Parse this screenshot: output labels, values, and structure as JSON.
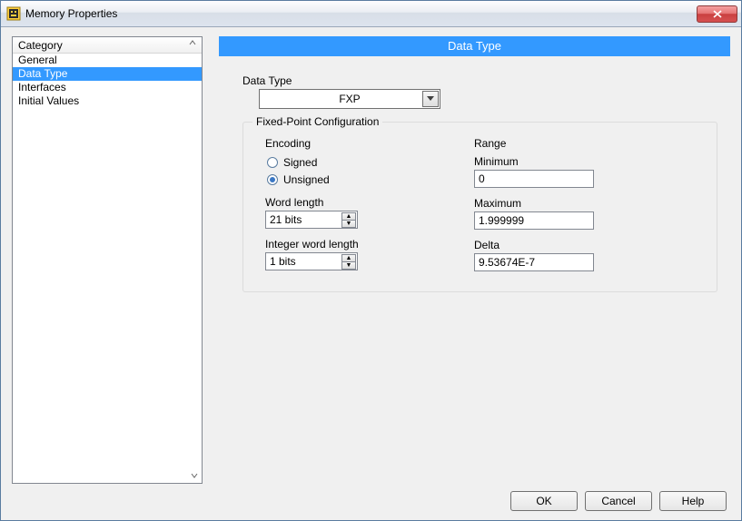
{
  "window": {
    "title": "Memory Properties"
  },
  "sidebar": {
    "header": "Category",
    "items": [
      {
        "label": "General",
        "selected": false
      },
      {
        "label": "Data Type",
        "selected": true
      },
      {
        "label": "Interfaces",
        "selected": false
      },
      {
        "label": "Initial Values",
        "selected": false
      }
    ]
  },
  "section": {
    "title": "Data Type"
  },
  "form": {
    "data_type_label": "Data Type",
    "data_type_value": "FXP",
    "group_legend": "Fixed-Point Configuration",
    "encoding": {
      "heading": "Encoding",
      "options": [
        {
          "label": "Signed",
          "checked": false
        },
        {
          "label": "Unsigned",
          "checked": true
        }
      ],
      "word_length_label": "Word length",
      "word_length_value": "21 bits",
      "int_word_length_label": "Integer word length",
      "int_word_length_value": "1 bits"
    },
    "range": {
      "heading": "Range",
      "minimum_label": "Minimum",
      "minimum_value": "0",
      "maximum_label": "Maximum",
      "maximum_value": "1.999999",
      "delta_label": "Delta",
      "delta_value": "9.53674E-7"
    }
  },
  "buttons": {
    "ok": "OK",
    "cancel": "Cancel",
    "help": "Help"
  }
}
